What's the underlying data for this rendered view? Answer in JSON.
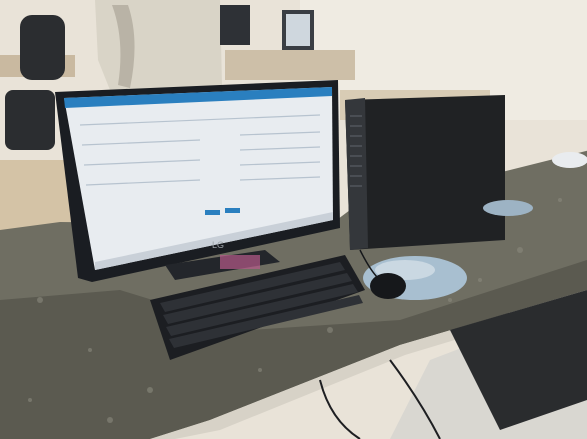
{
  "photo": {
    "description_alt": "",
    "monitor_brand": "LG"
  },
  "colors": {
    "wall": "#e6dfd3",
    "counter": "#6f6f63",
    "monitor_frame": "#1a1d22",
    "screen_bg": "#f3f5f7",
    "screen_header": "#2a7fbf",
    "keyboard": "#1c1e22",
    "tower": "#202224",
    "mousepad": "#a8bfd0"
  }
}
